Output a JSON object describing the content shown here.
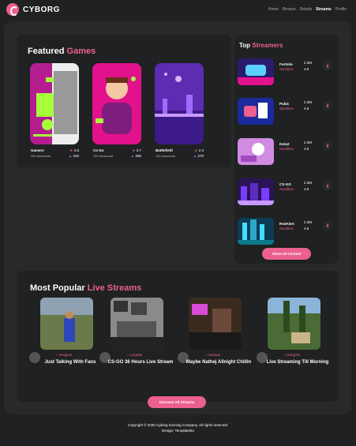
{
  "brand": {
    "name": "CYBORG"
  },
  "nav": [
    "Home",
    "Browse",
    "Details",
    "Streams",
    "Profile"
  ],
  "featured": {
    "title_plain": "Featured",
    "title_accent": "Games",
    "games": [
      {
        "name": "Gamers",
        "downloads": "260 download",
        "rating": "3.8",
        "dl_count": "220"
      },
      {
        "name": "Cs-Go",
        "downloads": "260 download",
        "rating": "3.7",
        "dl_count": "290"
      },
      {
        "name": "Battlefield",
        "downloads": "150 download",
        "rating": "2.3",
        "dl_count": "270"
      }
    ]
  },
  "top_streamers": {
    "title_plain": "Top",
    "title_accent": "Streamers",
    "items": [
      {
        "name": "Fortnite",
        "category": "Sandbox",
        "views": "2.3M",
        "rating": "4.9"
      },
      {
        "name": "PubG",
        "category": "Sandbox",
        "views": "2.3M",
        "rating": "4.9"
      },
      {
        "name": "Dota2",
        "category": "Sandbox",
        "views": "2.3M",
        "rating": "4.9"
      },
      {
        "name": "CS-GO",
        "category": "Sandbox",
        "views": "2.3M",
        "rating": "4.9"
      },
      {
        "name": "RedAlert",
        "category": "Sandbox",
        "views": "2.3M",
        "rating": "4.9"
      }
    ],
    "button": "Show all Content"
  },
  "live": {
    "title_plain": "Most Popular",
    "title_accent": "Live Streams",
    "streams": [
      {
        "user": "Kingson",
        "title": "Just Talking With Fans"
      },
      {
        "user": "LunaMa",
        "title": "CS-GO 36 Hours Live Stream"
      },
      {
        "user": "Areluwa",
        "title": "Maybe Nathej Allnight Chillin"
      },
      {
        "user": "GangTm",
        "title": "Live Streaming Till Morning"
      }
    ],
    "button": "Discover All Streams"
  },
  "footer": {
    "copyright": "Copyright © 2036 Cyborg Gaming Company. All rights reserved.",
    "design": "Design: TemplateMo"
  },
  "colors": {
    "accent": "#ec6090",
    "bg": "#1f2122",
    "panel": "#27292a"
  }
}
